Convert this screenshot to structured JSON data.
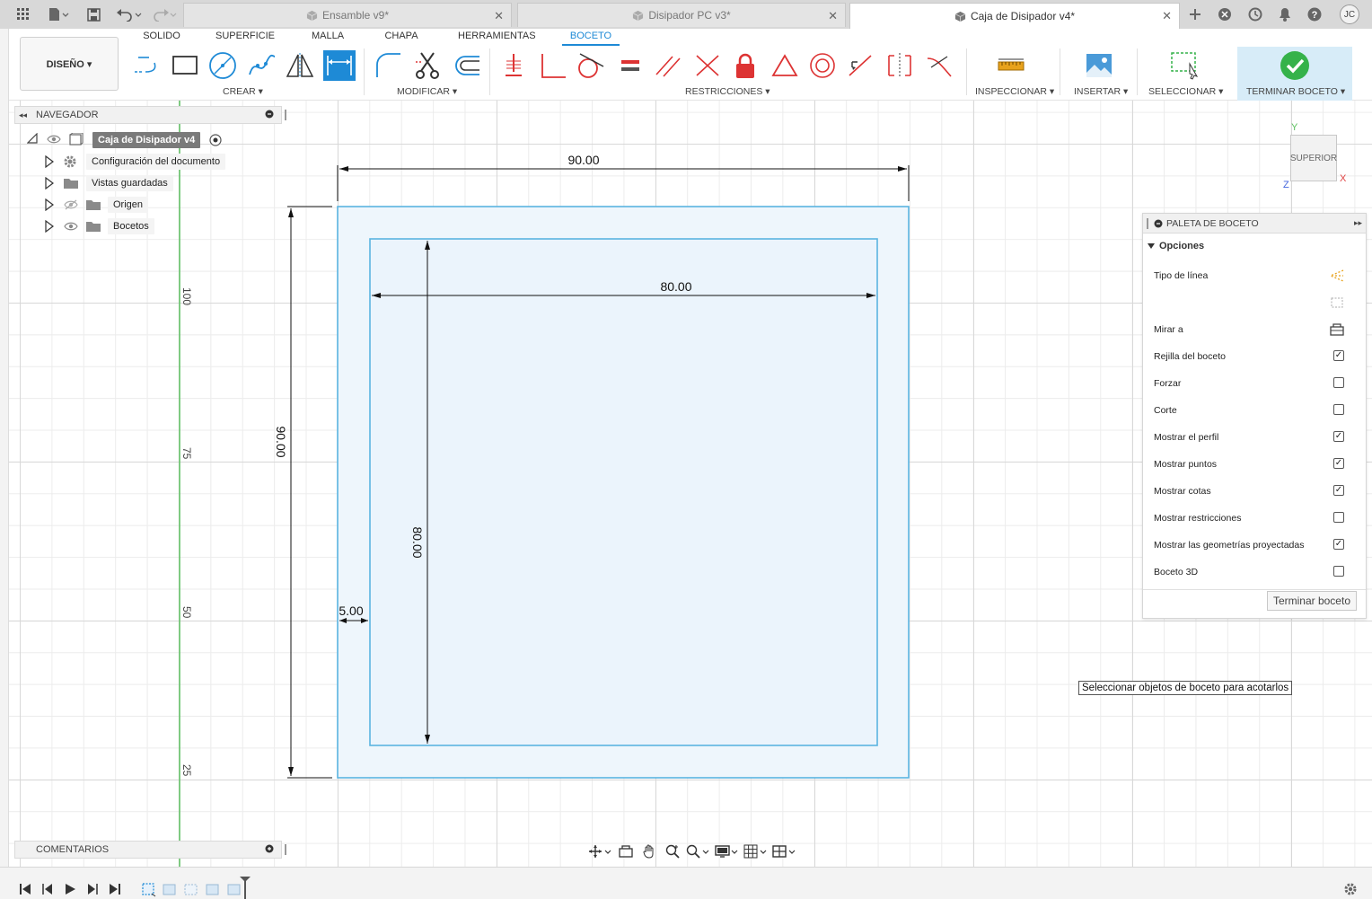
{
  "document_tabs": [
    {
      "label": "Ensamble v9*",
      "active": false
    },
    {
      "label": "Disipador PC v3*",
      "active": false
    },
    {
      "label": "Caja de Disipador v4*",
      "active": true
    }
  ],
  "user": {
    "initials": "JC"
  },
  "workspace": {
    "label": "DISEÑO ▾"
  },
  "toolbar_tabs": [
    "SOLIDO",
    "SUPERFICIE",
    "MALLA",
    "CHAPA",
    "HERRAMIENTAS",
    "BOCETO"
  ],
  "active_toolbar_tab": "BOCETO",
  "groups": {
    "create": "CREAR ▾",
    "modify": "MODIFICAR ▾",
    "constraints": "RESTRICCIONES ▾",
    "inspect": "INSPECCIONAR ▾",
    "insert": "INSERTAR ▾",
    "select": "SELECCIONAR ▾",
    "finish": "TERMINAR BOCETO ▾"
  },
  "navigator": {
    "title": "NAVEGADOR",
    "root": "Caja de Disipador v4",
    "items": [
      {
        "label": "Configuración del documento",
        "icon": "gear-icon"
      },
      {
        "label": "Vistas guardadas",
        "icon": "folder-icon"
      },
      {
        "label": "Origen",
        "icon": "folder-icon",
        "eye": "hidden"
      },
      {
        "label": "Bocetos",
        "icon": "folder-icon",
        "eye": "visible"
      }
    ]
  },
  "comments": {
    "title": "COMENTARIOS"
  },
  "palette": {
    "title": "PALETA DE BOCETO",
    "section": "Opciones",
    "rows": [
      {
        "label": "Tipo de línea",
        "control": "linetype-icon"
      },
      {
        "label": "",
        "control": "construction-icon"
      },
      {
        "label": "Mirar a",
        "control": "look-at-icon"
      },
      {
        "label": "Rejilla del boceto",
        "checked": true
      },
      {
        "label": "Forzar",
        "checked": false
      },
      {
        "label": "Corte",
        "checked": false
      },
      {
        "label": "Mostrar el perfil",
        "checked": true
      },
      {
        "label": "Mostrar puntos",
        "checked": true
      },
      {
        "label": "Mostrar cotas",
        "checked": true
      },
      {
        "label": "Mostrar restricciones",
        "checked": false
      },
      {
        "label": "Mostrar las geometrías proyectadas",
        "checked": true
      },
      {
        "label": "Boceto 3D",
        "checked": false
      }
    ],
    "finish_button": "Terminar boceto"
  },
  "tooltip": "Seleccionar objetos de boceto para acotarlos",
  "viewcube": {
    "face": "SUPERIOR",
    "axes": {
      "x": "X",
      "y": "Y",
      "z": "Z"
    }
  },
  "dimensions": {
    "outer_width": "90.00",
    "outer_height": "90.00",
    "inner_width": "80.00",
    "inner_height": "80.00",
    "offset": "5.00"
  },
  "ruler_ticks": [
    "100",
    "75",
    "50",
    "25"
  ],
  "colors": {
    "accent": "#1e8ad6",
    "sketch_line": "#5ab4e0",
    "profile_fill": "#eef6fc",
    "finish_check": "#35b24a",
    "axis_green": "#5dc060"
  }
}
